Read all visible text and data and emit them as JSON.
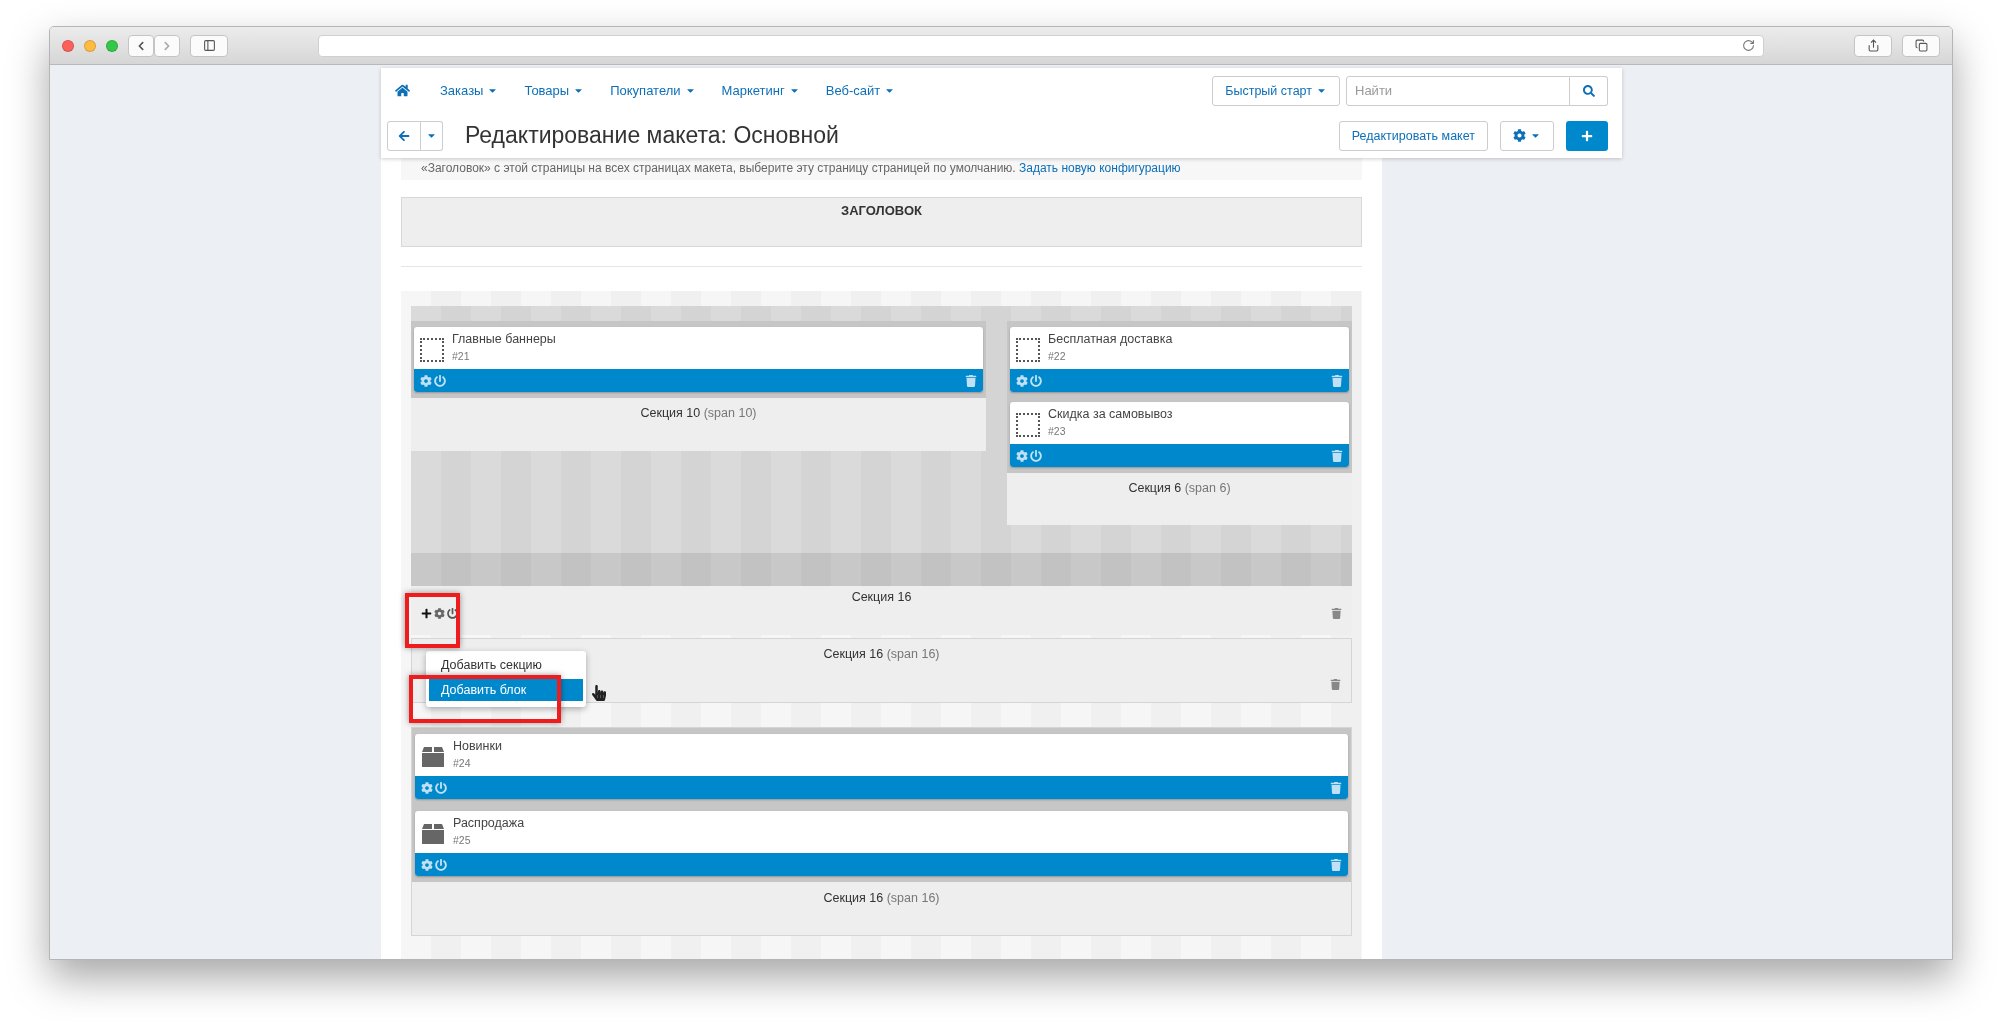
{
  "nav": {
    "items": [
      {
        "label": "Заказы"
      },
      {
        "label": "Товары"
      },
      {
        "label": "Покупатели"
      },
      {
        "label": "Маркетинг"
      },
      {
        "label": "Веб-сайт"
      }
    ],
    "quick_start": "Быстрый старт",
    "search": {
      "placeholder": "Найти"
    }
  },
  "title_bar": {
    "title": "Редактирование макета: Основной",
    "edit_button": "Редактировать макет"
  },
  "notice": {
    "text": "«Заголовок» с этой страницы на всех страницах макета, выберите эту страницу страницей по умолчанию.",
    "link": "Задать новую конфигурацию"
  },
  "header_section": {
    "title": "ЗАГОЛОВОК"
  },
  "layout": [
    {
      "kind": "container",
      "title": "Секция 16",
      "columns": [
        {
          "title": "Секция 10",
          "span": "(span 10)",
          "blocks": [
            {
              "kind": "placeholder",
              "name": "Главные баннеры",
              "id": "#21"
            }
          ]
        },
        {
          "title": "Секция 6",
          "span": "(span 6)",
          "blocks": [
            {
              "kind": "placeholder",
              "name": "Бесплатная доставка",
              "id": "#22"
            },
            {
              "kind": "placeholder",
              "name": "Скидка за самовывоз",
              "id": "#23"
            }
          ]
        }
      ]
    },
    {
      "kind": "section",
      "title": "Секция 16",
      "span": "(span 16)",
      "menu": {
        "items": [
          {
            "label": "Добавить секцию",
            "selected": false
          },
          {
            "label": "Добавить блок",
            "selected": true
          }
        ]
      }
    },
    {
      "kind": "section",
      "title": "Секция 16",
      "span": "(span 16)",
      "blocks": [
        {
          "kind": "product",
          "name": "Новинки",
          "id": "#24"
        },
        {
          "kind": "product",
          "name": "Распродажа",
          "id": "#25"
        }
      ]
    }
  ]
}
